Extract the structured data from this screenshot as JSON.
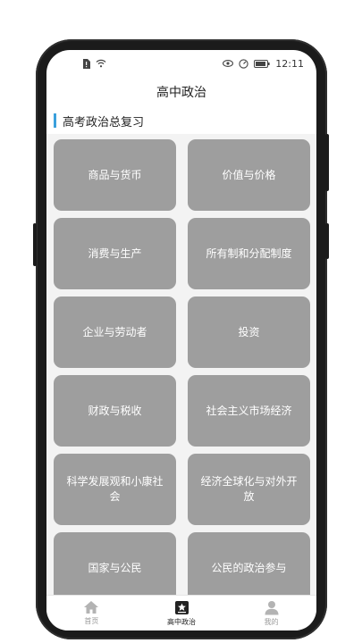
{
  "status_bar": {
    "time": "12:11",
    "icons": [
      "sim-alert-icon",
      "wifi-icon",
      "eye-icon",
      "speed-icon",
      "battery-icon"
    ]
  },
  "header": {
    "title": "高中政治"
  },
  "section": {
    "title": "高考政治总复习",
    "accent_color": "#3aa0dc"
  },
  "topics": [
    "商品与货币",
    "价值与价格",
    "消费与生产",
    "所有制和分配制度",
    "企业与劳动者",
    "投资",
    "财政与税收",
    "社会主义市场经济",
    "科学发展观和小康社会",
    "经济全球化与对外开放",
    "国家与公民",
    "公民的政治参与"
  ],
  "tabs": [
    {
      "label": "首页",
      "icon": "home-icon",
      "active": false
    },
    {
      "label": "高中政治",
      "icon": "star-icon",
      "active": true
    },
    {
      "label": "我的",
      "icon": "person-icon",
      "active": false
    }
  ],
  "colors": {
    "card_bg": "#9e9e9e",
    "content_bg": "#f3f3f3"
  }
}
